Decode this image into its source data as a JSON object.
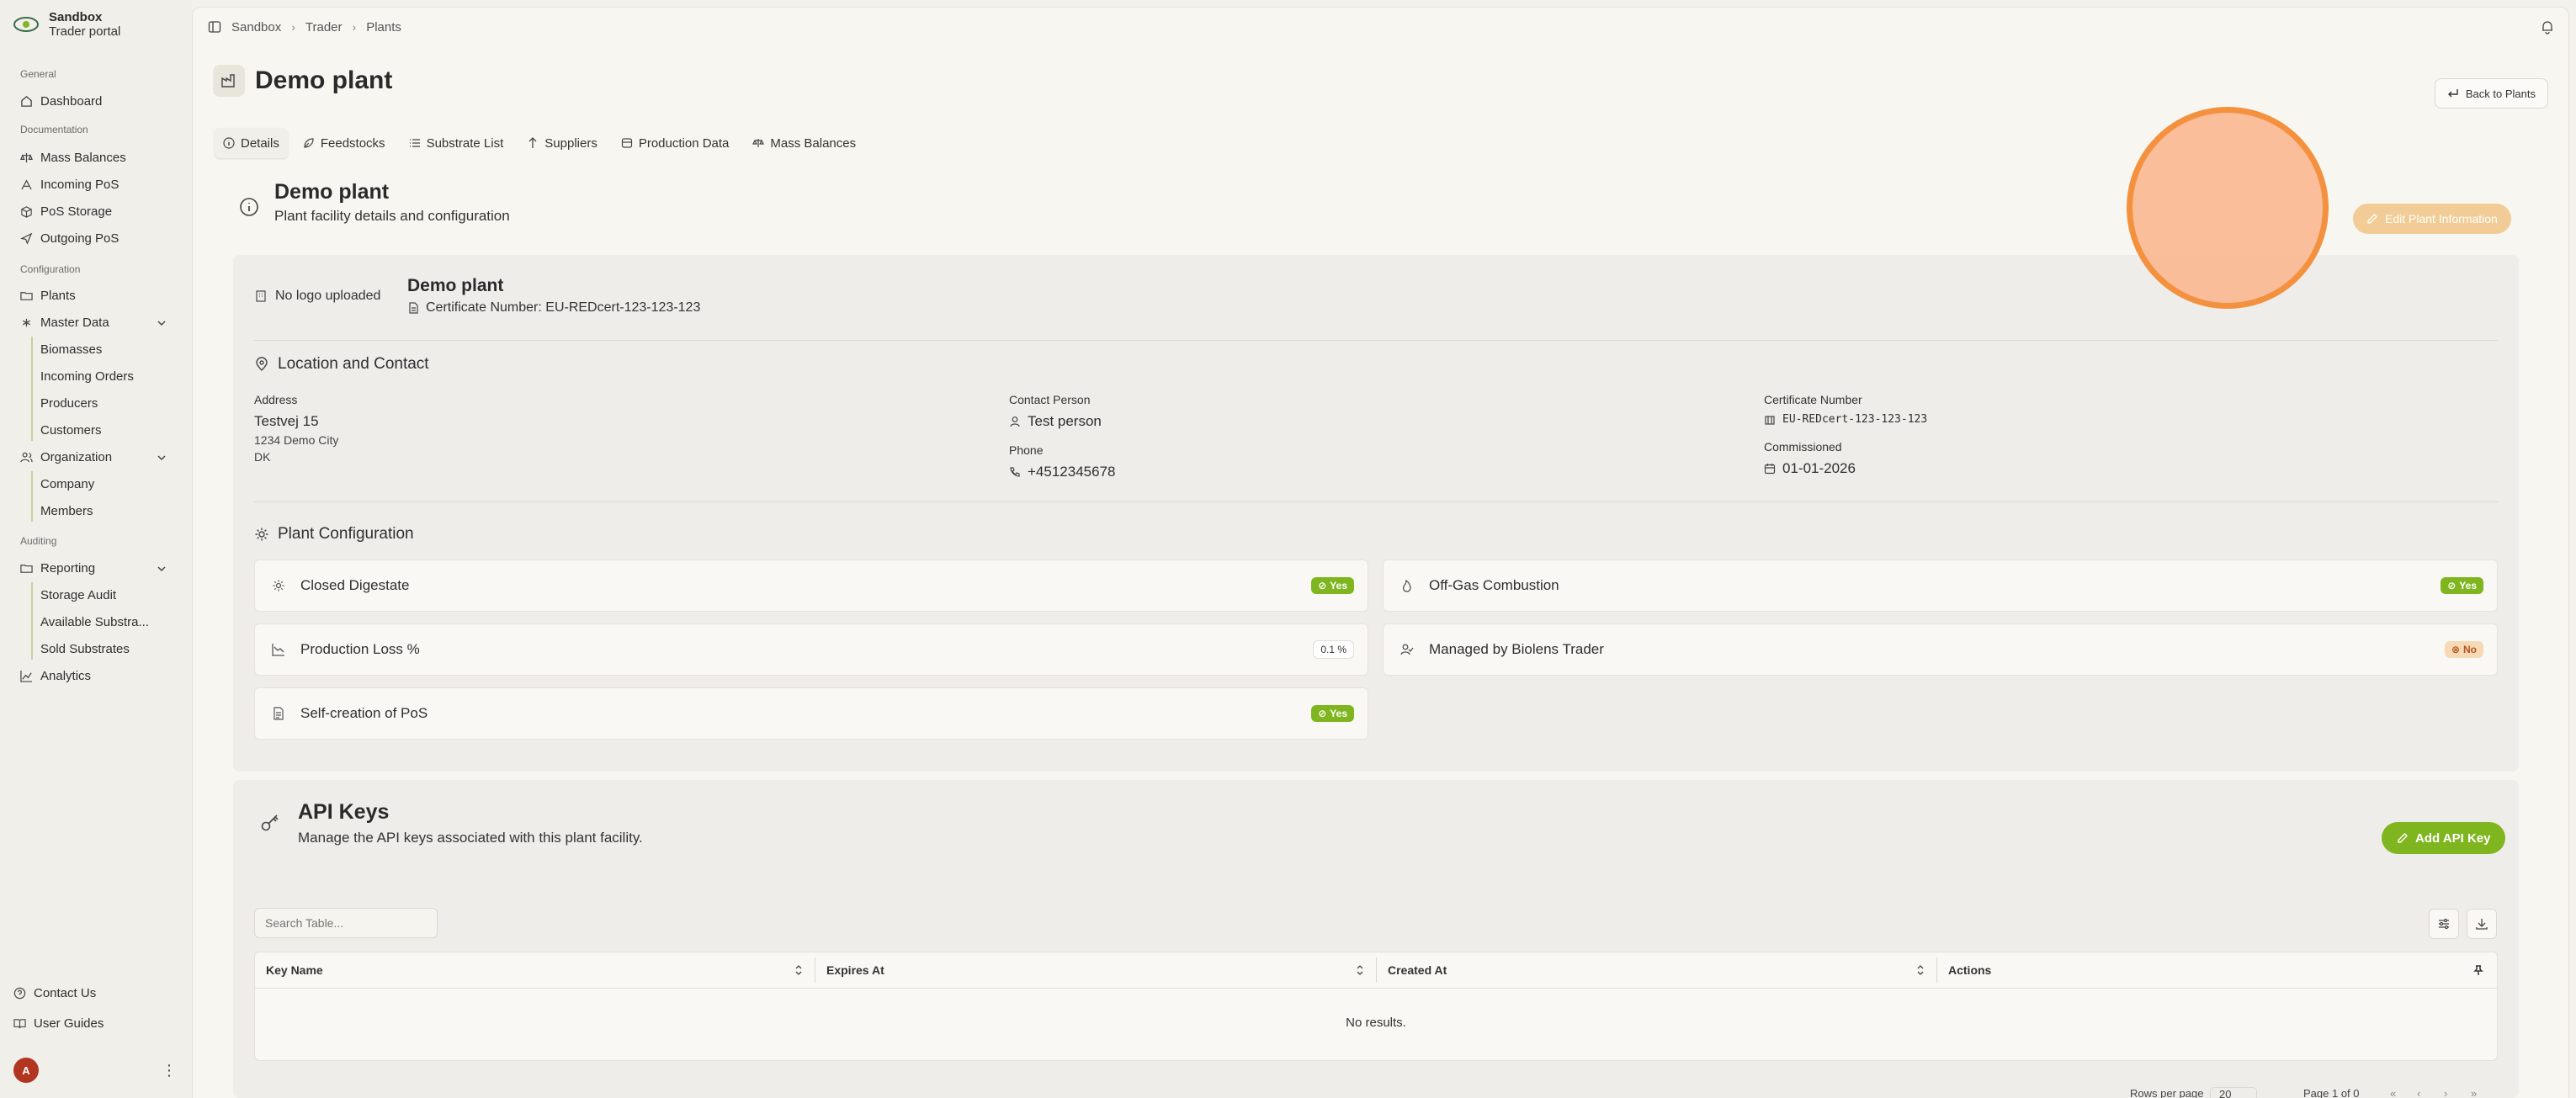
{
  "brand": {
    "title": "Sandbox",
    "subtitle": "Trader portal",
    "logo_icon": "eye-leaf-logo"
  },
  "sidebar": {
    "groups": {
      "general": "General",
      "documentation": "Documentation",
      "configuration": "Configuration",
      "auditing": "Auditing"
    },
    "items": {
      "dashboard": "Dashboard",
      "mass_balances": "Mass Balances",
      "incoming_pos": "Incoming PoS",
      "pos_storage": "PoS Storage",
      "outgoing_pos": "Outgoing PoS",
      "plants": "Plants",
      "master_data": "Master Data",
      "biomasses": "Biomasses",
      "incoming_orders": "Incoming Orders",
      "producers": "Producers",
      "customers": "Customers",
      "organization": "Organization",
      "company": "Company",
      "members": "Members",
      "reporting": "Reporting",
      "storage_audit": "Storage Audit",
      "available_substrates": "Available Substra...",
      "sold_substrates": "Sold Substrates",
      "analytics": "Analytics",
      "contact_us": "Contact Us",
      "user_guides": "User Guides"
    },
    "avatar_initial": "A"
  },
  "breadcrumb": [
    "Sandbox",
    "Trader",
    "Plants"
  ],
  "page": {
    "title": "Demo plant",
    "back_label": "Back to Plants"
  },
  "tabs": [
    "Details",
    "Feedstocks",
    "Substrate List",
    "Suppliers",
    "Production Data",
    "Mass Balances"
  ],
  "details": {
    "title": "Demo plant",
    "subtitle": "Plant facility details and configuration",
    "edit_label": "Edit Plant Information",
    "no_logo": "No logo uploaded",
    "plant_name": "Demo plant",
    "cert_line": "Certificate Number: EU-REDcert-123-123-123"
  },
  "location": {
    "heading": "Location and Contact",
    "address_label": "Address",
    "street": "Testvej 15",
    "city": "1234 Demo City",
    "country": "DK",
    "contact_label": "Contact Person",
    "contact": "Test person",
    "phone_label": "Phone",
    "phone": "+4512345678",
    "cert_label": "Certificate Number",
    "cert": "EU-REDcert-123-123-123",
    "commissioned_label": "Commissioned",
    "commissioned": "01-01-2026"
  },
  "config": {
    "heading": "Plant Configuration",
    "rows": [
      {
        "label": "Closed Digestate",
        "value": "Yes"
      },
      {
        "label": "Off-Gas Combustion",
        "value": "Yes"
      },
      {
        "label": "Production Loss %",
        "value": "0.1 %"
      },
      {
        "label": "Managed by Biolens Trader",
        "value": "No"
      },
      {
        "label": "Self-creation of PoS",
        "value": "Yes"
      }
    ]
  },
  "api": {
    "title": "API Keys",
    "subtitle": "Manage the API keys associated with this plant facility.",
    "add_label": "Add API Key",
    "search_placeholder": "Search Table...",
    "columns": [
      "Key Name",
      "Expires At",
      "Created At",
      "Actions"
    ],
    "empty": "No results.",
    "rows_per_page_label": "Rows per page",
    "rows_per_page": "20",
    "page_info": "Page 1 of 0"
  },
  "colors": {
    "accent_green": "#7fb51e",
    "highlight_orange": "#f3913e"
  }
}
